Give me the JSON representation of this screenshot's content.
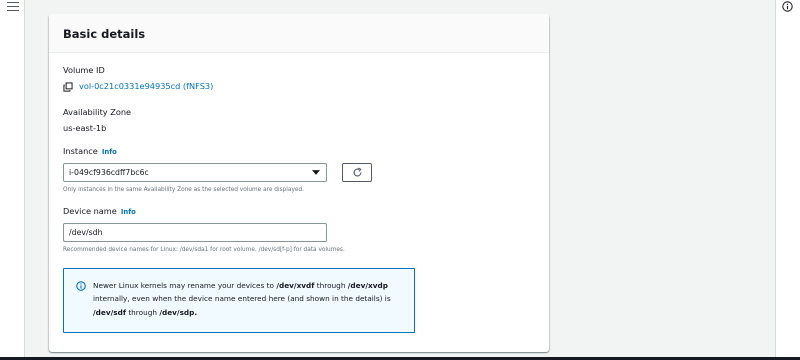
{
  "section": {
    "title": "Basic details"
  },
  "volume": {
    "label": "Volume ID",
    "value": "vol-0c21c0331e94935cd (fNFS3)"
  },
  "availability_zone": {
    "label": "Availability Zone",
    "value": "us-east-1b"
  },
  "instance": {
    "label": "Instance",
    "info": "Info",
    "selected": "i-049cf936cdff7bc6c",
    "hint": "Only instances in the same Availability Zone as the selected volume are displayed."
  },
  "device": {
    "label": "Device name",
    "info": "Info",
    "value": "/dev/sdh",
    "hint": "Recommended device names for Linux: /dev/sda1 for root volume. /dev/sd[f-p] for data volumes."
  },
  "alert": {
    "t1": "Newer Linux kernels may rename your devices to ",
    "b1": "/dev/xvdf",
    "t2": " through ",
    "b2": "/dev/xvdp",
    "t3": " internally, even when the device name entered here (and shown in the details) is ",
    "b3": "/dev/sdf",
    "t4": " through ",
    "b4": "/dev/sdp."
  },
  "colors": {
    "link": "#0073bb",
    "alert_border": "#0073bb",
    "alert_bg": "#f1faff",
    "page_bg": "#f2f3f3"
  },
  "icons": [
    "menu-icon",
    "info-circle-icon",
    "copy-icon",
    "caret-down-icon",
    "refresh-icon",
    "info-alert-icon"
  ]
}
